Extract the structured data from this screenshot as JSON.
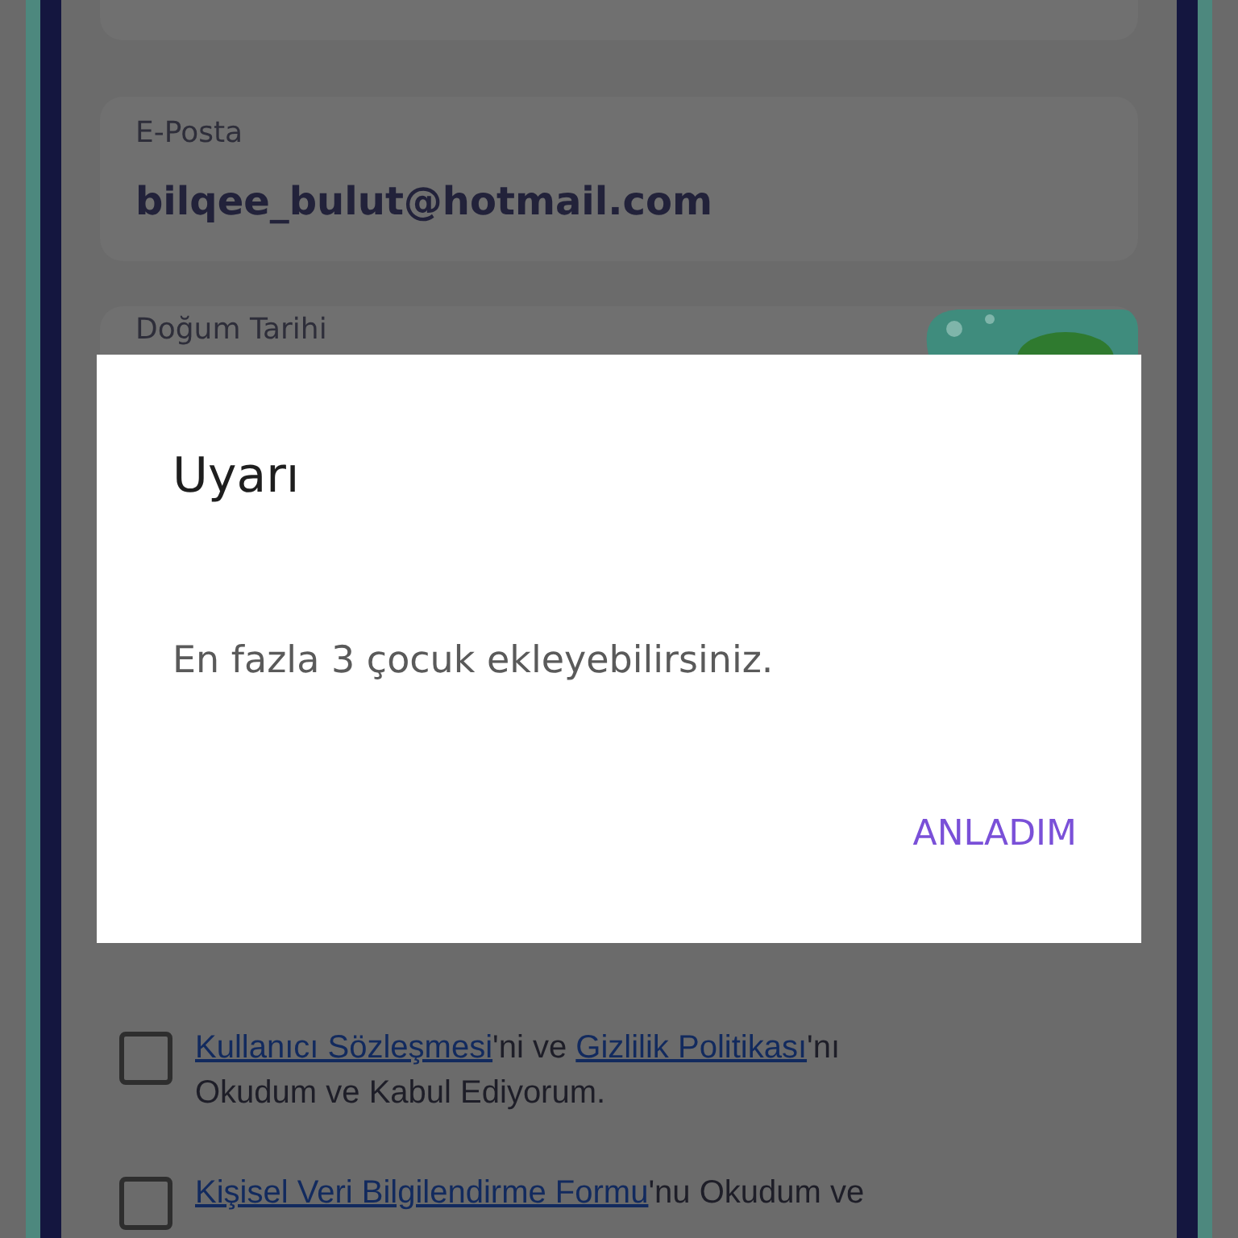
{
  "form": {
    "fields": [
      {
        "label": "E-Posta",
        "value": "bilqee_bulut@hotmail.com"
      },
      {
        "label": "Doğum Tarihi"
      }
    ],
    "agreements": [
      {
        "checked": false,
        "parts": [
          {
            "kind": "link",
            "text": "Kullanıcı Sözleşmesi"
          },
          {
            "kind": "text",
            "text": "'ni ve "
          },
          {
            "kind": "link",
            "text": "Gizlilik Politikası"
          },
          {
            "kind": "text",
            "text": "'nı Okudum ve Kabul Ediyorum."
          }
        ]
      },
      {
        "checked": false,
        "parts": [
          {
            "kind": "link",
            "text": "Kişisel Veri Bilgilendirme Formu"
          },
          {
            "kind": "text",
            "text": "'nu Okudum ve"
          }
        ]
      }
    ]
  },
  "dialog": {
    "title": "Uyarı",
    "message": "En fazla 3 çocuk ekleyebilirsiniz.",
    "button": "ANLADIM"
  }
}
